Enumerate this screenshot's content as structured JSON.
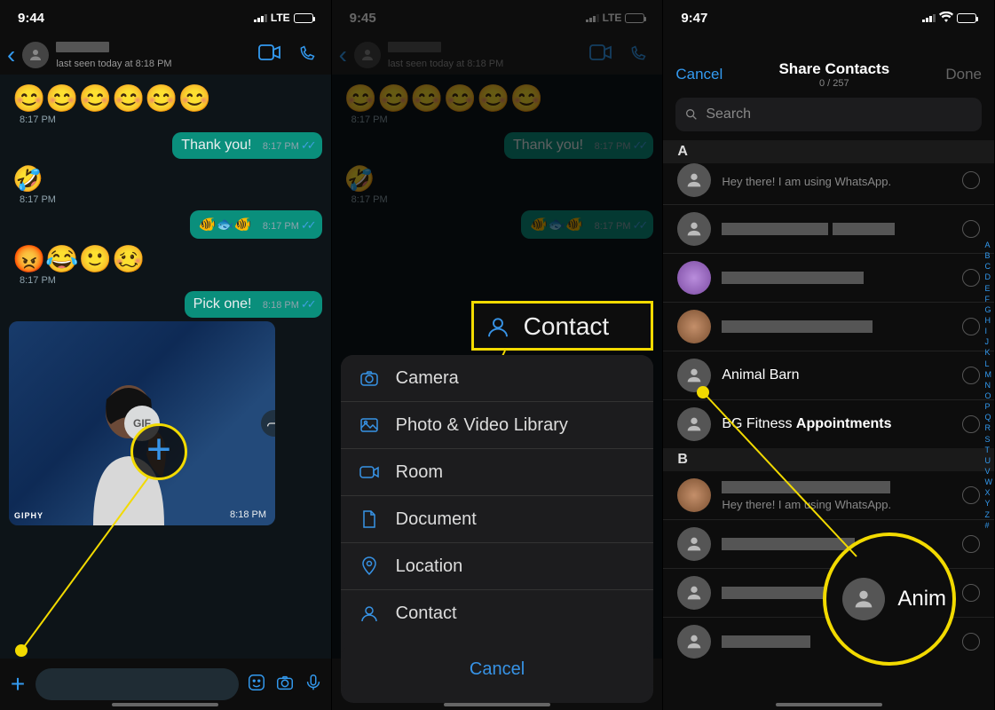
{
  "screen1": {
    "time": "9:44",
    "net": "LTE",
    "header": {
      "last_seen": "last seen today at 8:18 PM"
    },
    "messages": {
      "emoji1": "😊😊😊😊😊😊",
      "time1": "8:17 PM",
      "thank_you": "Thank you!",
      "time2": "8:17 PM",
      "laugh": "🤣",
      "time3": "8:17 PM",
      "fish": "🐠🐟🐠",
      "time4": "8:17 PM",
      "emoji5": "😡😂🙂🥴",
      "time5": "8:17 PM",
      "pick": "Pick one!",
      "time6": "8:18 PM",
      "gif_label": "GIF",
      "gif_brand": "GIPHY",
      "time7": "8:18 PM"
    }
  },
  "screen2": {
    "time": "9:45",
    "net": "LTE",
    "header": {
      "last_seen": "last seen today at 8:18 PM"
    },
    "chat": {
      "thank_you": "Thank you!",
      "t1": "8:17 PM",
      "laugh": "🤣",
      "t2": "8:17 PM",
      "fish": "🐠🐟🐠",
      "t3": "8:17 PM"
    },
    "sheet": {
      "camera": "Camera",
      "library": "Photo & Video Library",
      "room": "Room",
      "document": "Document",
      "location": "Location",
      "contact": "Contact",
      "cancel": "Cancel"
    },
    "zoom_label": "Contact"
  },
  "screen3": {
    "time": "9:47",
    "header": {
      "cancel": "Cancel",
      "title": "Share Contacts",
      "count": "0 / 257",
      "done": "Done"
    },
    "search_placeholder": "Search",
    "sectionA": "A",
    "sectionB": "B",
    "status_default": "Hey there! I am using WhatsApp.",
    "contacts": {
      "animal_barn": "Animal Barn",
      "bg_pre": "BG Fitness ",
      "bg_bold": "Appointments"
    },
    "index": [
      "A",
      "B",
      "C",
      "D",
      "E",
      "F",
      "G",
      "H",
      "I",
      "J",
      "K",
      "L",
      "M",
      "N",
      "O",
      "P",
      "Q",
      "R",
      "S",
      "T",
      "U",
      "V",
      "W",
      "X",
      "Y",
      "Z",
      "#"
    ],
    "zoom_label": "Anim"
  }
}
